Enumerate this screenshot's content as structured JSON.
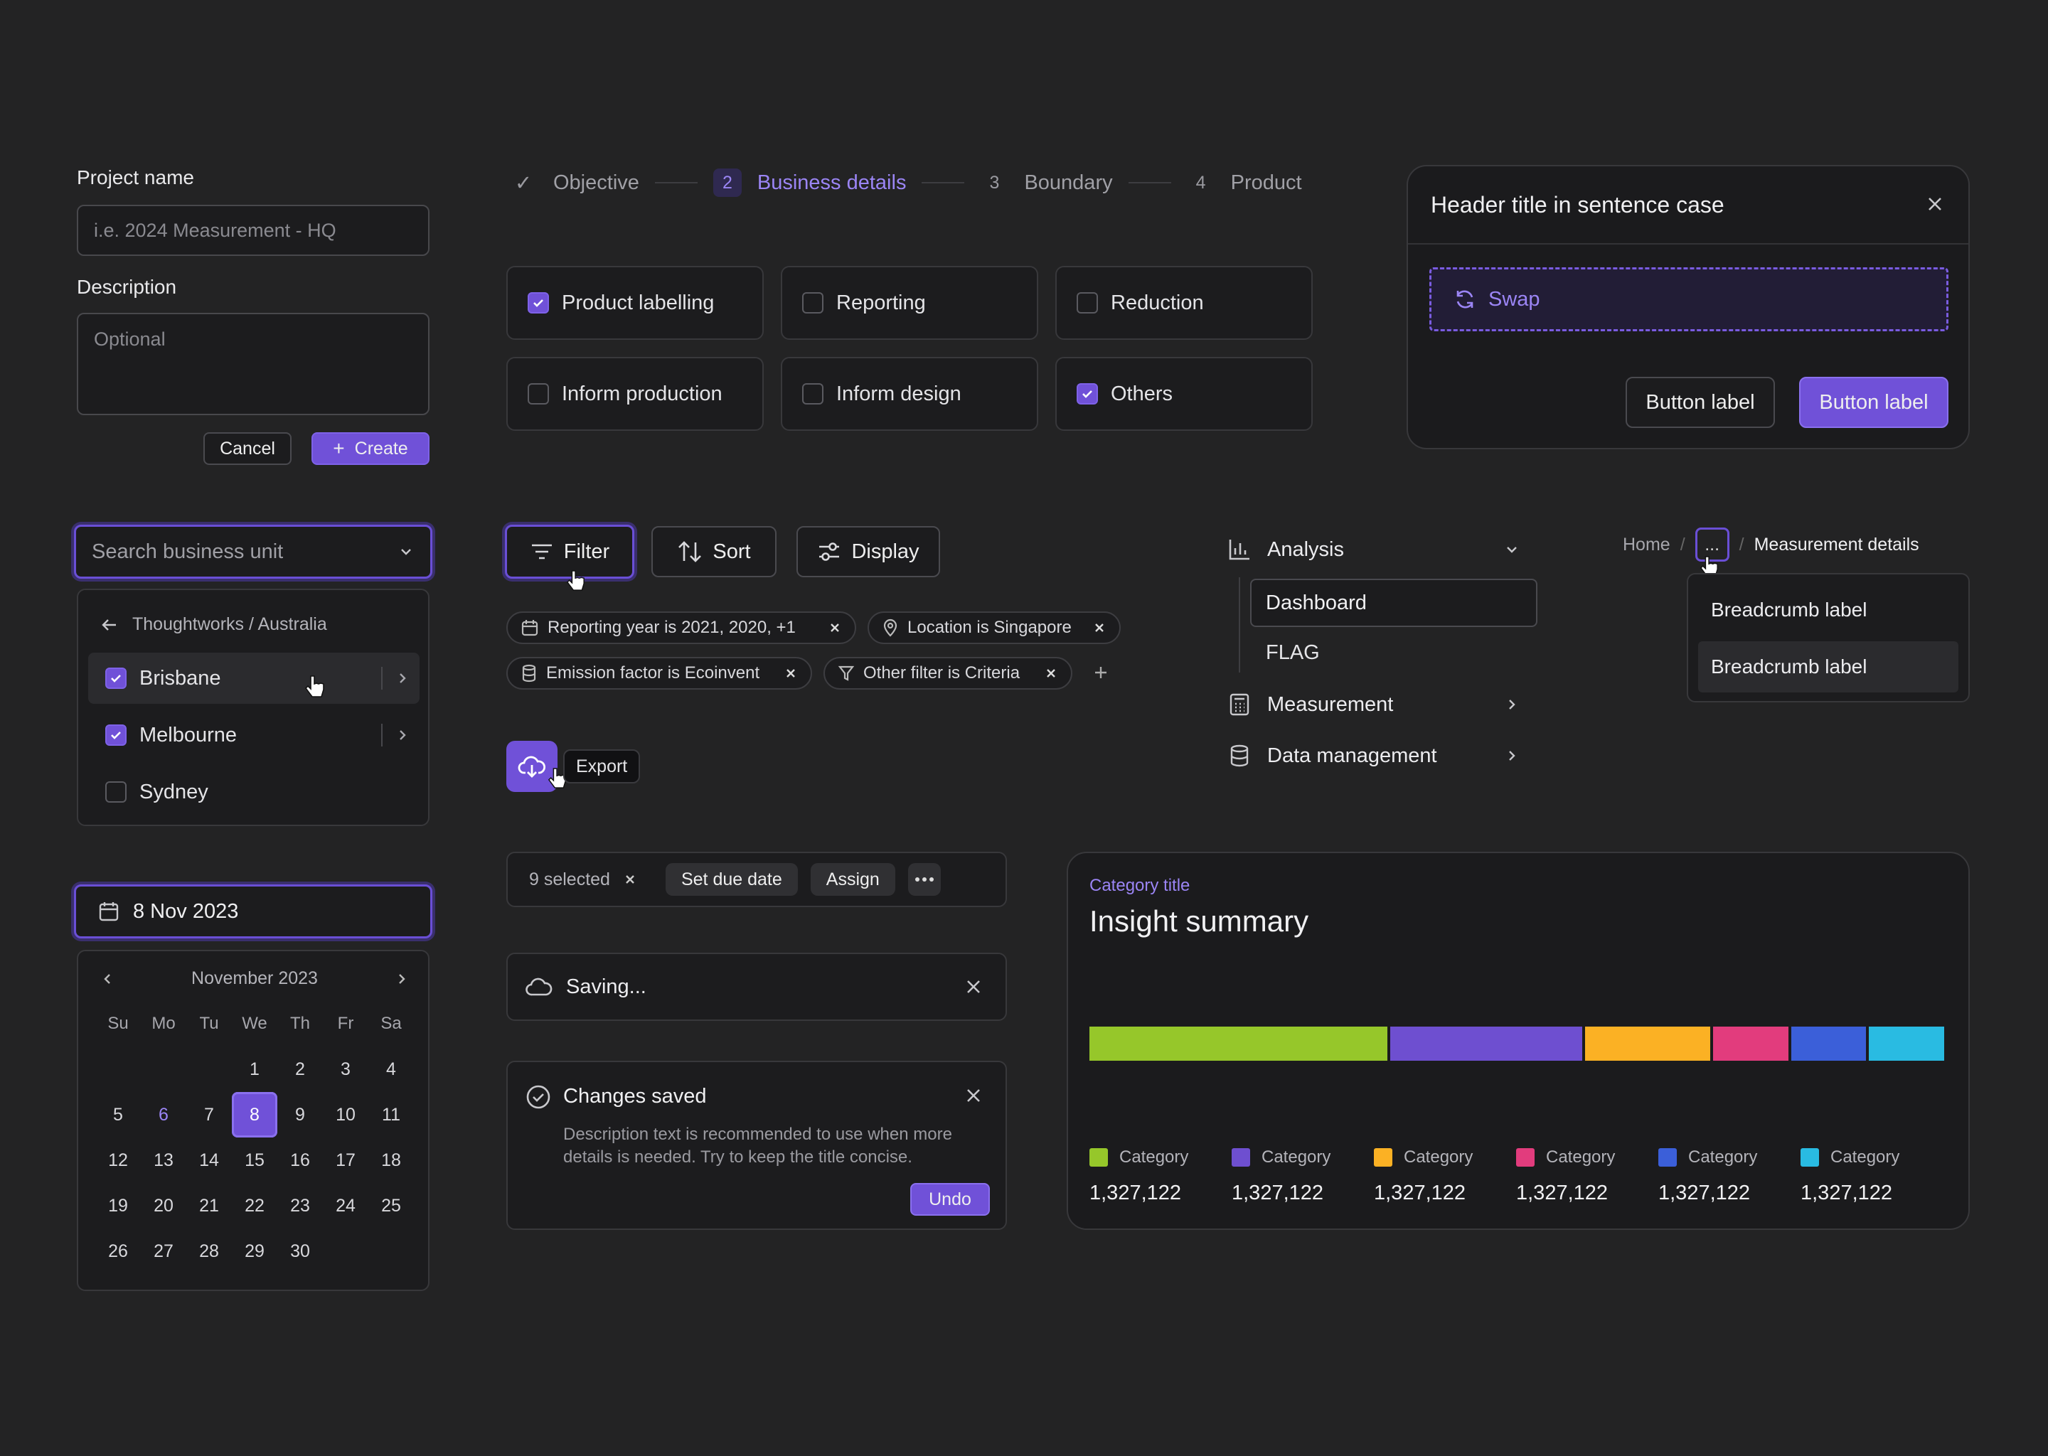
{
  "project_form": {
    "name_label": "Project name",
    "name_placeholder": "i.e. 2024 Measurement - HQ",
    "desc_label": "Description",
    "desc_placeholder": "Optional",
    "cancel": "Cancel",
    "create": "Create"
  },
  "stepper": {
    "steps": [
      {
        "num": "✓",
        "label": "Objective"
      },
      {
        "num": "2",
        "label": "Business details"
      },
      {
        "num": "3",
        "label": "Boundary"
      },
      {
        "num": "4",
        "label": "Product"
      }
    ]
  },
  "options": [
    {
      "label": "Product labelling",
      "checked": true
    },
    {
      "label": "Reporting",
      "checked": false
    },
    {
      "label": "Reduction",
      "checked": false
    },
    {
      "label": "Inform production",
      "checked": false
    },
    {
      "label": "Inform design",
      "checked": false
    },
    {
      "label": "Others",
      "checked": true
    }
  ],
  "modal": {
    "title": "Header title in sentence case",
    "swap": "Swap",
    "secondary": "Button label",
    "primary": "Button label"
  },
  "business_select": {
    "placeholder": "Search business unit",
    "crumb": "Thoughtworks / Australia",
    "items": [
      {
        "label": "Brisbane",
        "checked": true
      },
      {
        "label": "Melbourne",
        "checked": true
      },
      {
        "label": "Sydney",
        "checked": false
      }
    ]
  },
  "toolbar": {
    "filter": "Filter",
    "sort": "Sort",
    "display": "Display"
  },
  "filters": [
    "Reporting year is 2021, 2020, +1",
    "Location is Singapore",
    "Emission factor is Ecoinvent",
    "Other filter is Criteria"
  ],
  "export_tooltip": "Export",
  "nav": {
    "analysis": "Analysis",
    "dashboard": "Dashboard",
    "flag": "FLAG",
    "measurement": "Measurement",
    "data_management": "Data management"
  },
  "breadcrumb": {
    "home": "Home",
    "sep": "/",
    "ellipsis": "...",
    "current": "Measurement details",
    "menu": [
      "Breadcrumb label",
      "Breadcrumb label"
    ]
  },
  "date": {
    "value": "8 Nov 2023",
    "month": "November 2023",
    "weekdays": [
      "Su",
      "Mo",
      "Tu",
      "We",
      "Th",
      "Fr",
      "Sa"
    ],
    "selected": "8",
    "highlight": "6",
    "weeks": [
      [
        "",
        "",
        "",
        "1",
        "2",
        "3",
        "4"
      ],
      [
        "5",
        "6",
        "7",
        "8",
        "9",
        "10",
        "11"
      ],
      [
        "12",
        "13",
        "14",
        "15",
        "16",
        "17",
        "18"
      ],
      [
        "19",
        "20",
        "21",
        "22",
        "23",
        "24",
        "25"
      ],
      [
        "26",
        "27",
        "28",
        "29",
        "30",
        "",
        ""
      ]
    ]
  },
  "bulk": {
    "selected": "9 selected",
    "due": "Set due date",
    "assign": "Assign"
  },
  "saving": "Saving...",
  "toast": {
    "title": "Changes saved",
    "body": "Description text is recommended to use when more details is needed. Try to keep the title concise.",
    "undo": "Undo"
  },
  "insight": {
    "category_title": "Category title",
    "title": "Insight summary",
    "segments": [
      {
        "color": "#96c72a",
        "share": 0.353
      },
      {
        "color": "#6e4fd0",
        "share": 0.227
      },
      {
        "color": "#fbb124",
        "share": 0.148
      },
      {
        "color": "#e23c7d",
        "share": 0.089
      },
      {
        "color": "#3b5fd9",
        "share": 0.089
      },
      {
        "color": "#29bbe2",
        "share": 0.089
      }
    ],
    "legend": [
      {
        "label": "Category",
        "value": "1,327,122",
        "color": "#96c72a"
      },
      {
        "label": "Category",
        "value": "1,327,122",
        "color": "#6e4fd0"
      },
      {
        "label": "Category",
        "value": "1,327,122",
        "color": "#fbb124"
      },
      {
        "label": "Category",
        "value": "1,327,122",
        "color": "#e23c7d"
      },
      {
        "label": "Category",
        "value": "1,327,122",
        "color": "#3b5fd9"
      },
      {
        "label": "Category",
        "value": "1,327,122",
        "color": "#29bbe2"
      }
    ]
  }
}
